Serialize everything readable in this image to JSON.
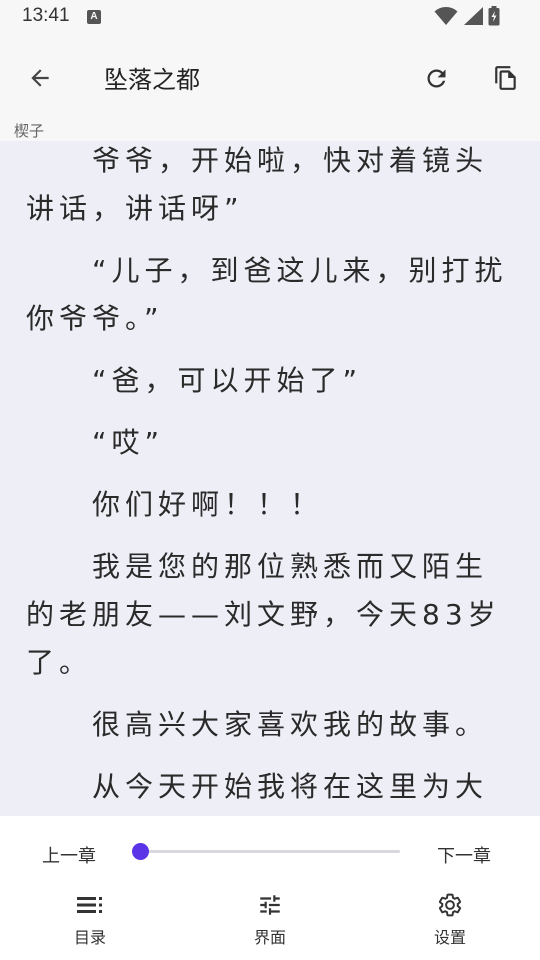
{
  "status_bar": {
    "time": "13:41",
    "notification_badge": "A"
  },
  "app_bar": {
    "title": "坠落之都",
    "icons": [
      "arrow-back-icon",
      "refresh-icon",
      "copy-icon"
    ]
  },
  "chapter_label": "楔子",
  "content": {
    "paragraphs": [
      "爷爷，开始啦，快对着镜头讲话，讲话呀”",
      "“儿子，到爸这儿来，别打扰你爷爷。”",
      "“爸，可以开始了”",
      "“哎”",
      "你们好啊！！！",
      "我是您的那位熟悉而又陌生的老朋友——刘文野，今天83岁了。",
      "很高兴大家喜欢我的故事。",
      "从今天开始我将在这里为大"
    ]
  },
  "bottom_panel": {
    "prev_chapter": "上一章",
    "next_chapter": "下一章",
    "progress": 0.0,
    "accent_color": "#5a34e6",
    "nav": [
      {
        "label": "目录",
        "icon": "list-icon"
      },
      {
        "label": "界面",
        "icon": "tune-icon"
      },
      {
        "label": "设置",
        "icon": "gear-icon"
      }
    ]
  }
}
